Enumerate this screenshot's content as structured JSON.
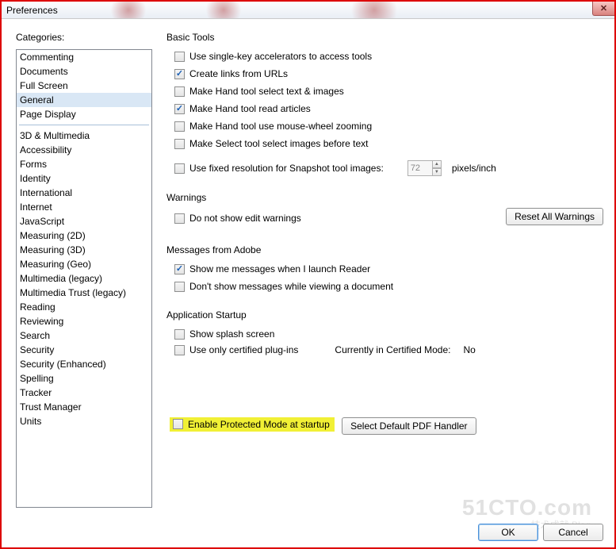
{
  "window": {
    "title": "Preferences"
  },
  "sidebar": {
    "label": "Categories:",
    "primary": [
      "Commenting",
      "Documents",
      "Full Screen",
      "General",
      "Page Display"
    ],
    "selected_index": 3,
    "secondary": [
      "3D & Multimedia",
      "Accessibility",
      "Forms",
      "Identity",
      "International",
      "Internet",
      "JavaScript",
      "Measuring (2D)",
      "Measuring (3D)",
      "Measuring (Geo)",
      "Multimedia (legacy)",
      "Multimedia Trust (legacy)",
      "Reading",
      "Reviewing",
      "Search",
      "Security",
      "Security (Enhanced)",
      "Spelling",
      "Tracker",
      "Trust Manager",
      "Units"
    ]
  },
  "basic_tools": {
    "title": "Basic Tools",
    "items": [
      {
        "label": "Use single-key accelerators to access tools",
        "checked": false
      },
      {
        "label": "Create links from URLs",
        "checked": true
      },
      {
        "label": "Make Hand tool select text & images",
        "checked": false
      },
      {
        "label": "Make Hand tool read articles",
        "checked": true
      },
      {
        "label": "Make Hand tool use mouse-wheel zooming",
        "checked": false
      },
      {
        "label": "Make Select tool select images before text",
        "checked": false
      }
    ],
    "snapshot": {
      "label": "Use fixed resolution for Snapshot tool images:",
      "checked": false,
      "value": "72",
      "unit": "pixels/inch"
    }
  },
  "warnings": {
    "title": "Warnings",
    "item": {
      "label": "Do not show edit warnings",
      "checked": false
    },
    "reset_btn": "Reset All Warnings"
  },
  "messages": {
    "title": "Messages from Adobe",
    "items": [
      {
        "label": "Show me messages when I launch Reader",
        "checked": true
      },
      {
        "label": "Don't show messages while viewing a document",
        "checked": false
      }
    ]
  },
  "startup": {
    "title": "Application Startup",
    "splash": {
      "label": "Show splash screen",
      "checked": false
    },
    "certified": {
      "label": "Use only certified plug-ins",
      "checked": false
    },
    "certified_mode_label": "Currently in Certified Mode:",
    "certified_mode_value": "No",
    "protected": {
      "label": "Enable Protected Mode at startup",
      "checked": false
    },
    "handler_btn": "Select Default PDF Handler"
  },
  "footer": {
    "ok": "OK",
    "cancel": "Cancel"
  },
  "watermark": {
    "main": "51CTO.com",
    "sub": "技术成就 Blog"
  }
}
